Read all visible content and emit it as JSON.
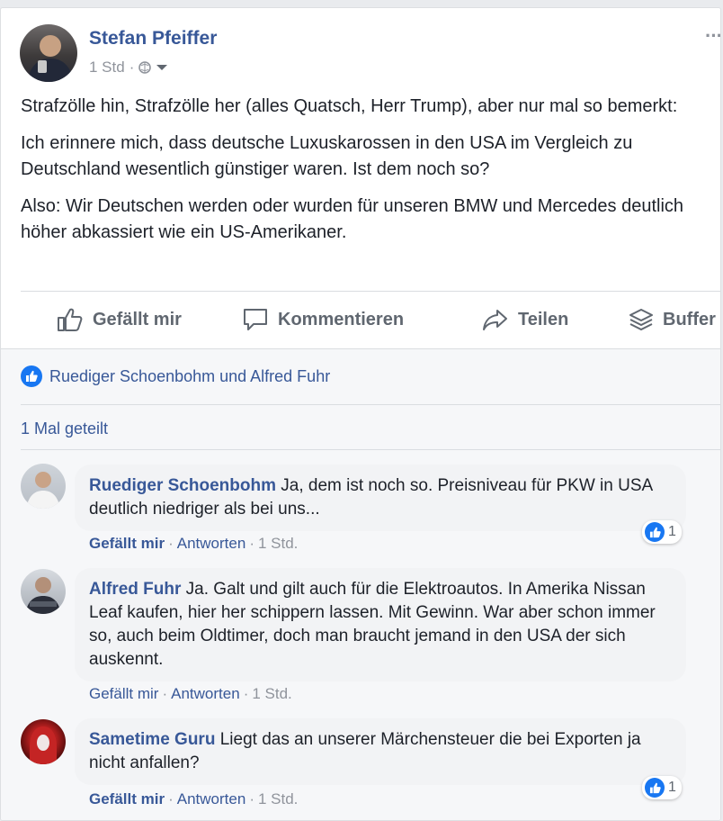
{
  "post": {
    "author": "Stefan Pfeiffer",
    "time": "1 Std",
    "time_sep": "·",
    "paragraphs": [
      "Strafzölle hin, Strafzölle her (alles Quatsch, Herr Trump), aber nur mal so bemerkt:",
      "Ich erinnere mich, dass deutsche Luxuskarossen in den USA im Vergleich zu Deutschland wesentlich günstiger waren. Ist dem noch so?",
      "Also: Wir Deutschen werden oder wurden für unseren BMW und Mercedes deutlich höher abkassiert wie ein US-Amerikaner."
    ],
    "more": "···"
  },
  "actions": {
    "like": "Gefällt mir",
    "comment": "Kommentieren",
    "share": "Teilen",
    "buffer": "Buffer"
  },
  "reactions": {
    "names": "Ruediger Schoenbohm und Alfred Fuhr"
  },
  "shares": {
    "text": "1 Mal geteilt"
  },
  "comments": [
    {
      "author": "Ruediger Schoenbohm",
      "text": "Ja, dem ist noch so. Preisniveau für PKW in USA deutlich niedriger als bei uns...",
      "like": "Gefällt mir",
      "reply": "Antworten",
      "time": "1 Std.",
      "likes": "1"
    },
    {
      "author": "Alfred Fuhr",
      "text": "Ja. Galt und gilt auch für die Elektroautos. In Amerika Nissan Leaf kaufen, hier her schippern lassen. Mit Gewinn. War aber schon immer so, auch beim Oldtimer, doch man braucht jemand in den USA der sich auskennt.",
      "like": "Gefällt mir",
      "reply": "Antworten",
      "time": "1 Std."
    },
    {
      "author": "Sametime Guru",
      "text": "Liegt das an unserer Märchensteuer die bei Exporten ja nicht anfallen?",
      "like": "Gefällt mir",
      "reply": "Antworten",
      "time": "1 Std.",
      "likes": "1"
    }
  ],
  "colors": {
    "link": "#385898",
    "like_blue": "#1877f2",
    "bubble": "#f2f3f5"
  }
}
